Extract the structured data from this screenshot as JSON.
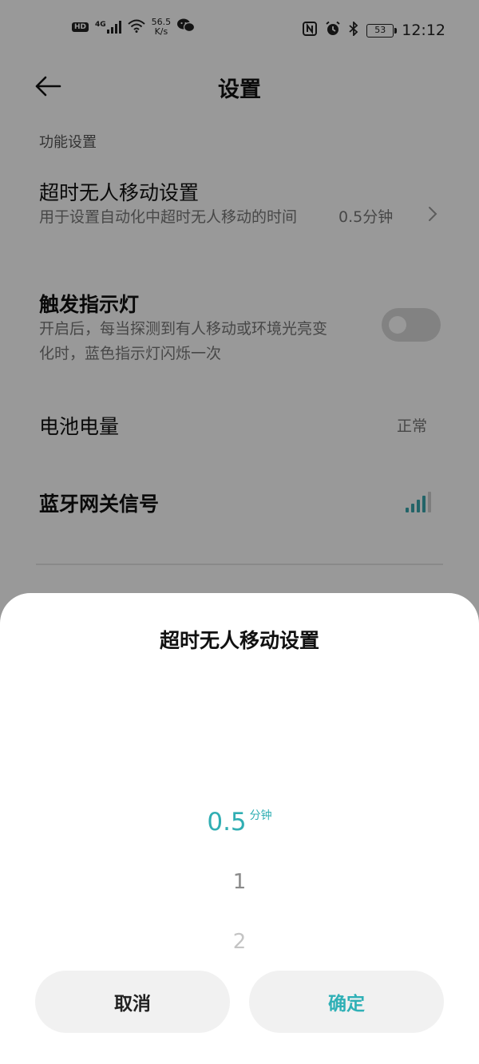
{
  "status_bar": {
    "hd_badge": "HD",
    "network": "4G",
    "speed_value": "56.5",
    "speed_unit": "K/s",
    "battery_level": "53",
    "time": "12:12",
    "left_icons": [
      "hd-icon",
      "signal-4g-icon",
      "wifi-icon",
      "wechat-icon"
    ],
    "right_icons": [
      "nfc-icon",
      "alarm-icon",
      "bluetooth-icon",
      "battery-icon"
    ]
  },
  "header": {
    "title": "设置",
    "back_icon": "arrow-left-icon"
  },
  "section": {
    "title": "功能设置"
  },
  "settings": {
    "timeout": {
      "title": "超时无人移动设置",
      "description": "用于设置自动化中超时无人移动的时间",
      "value": "0.5分钟"
    },
    "indicator": {
      "title": "触发指示灯",
      "description": "开启后，每当探测到有人移动或环境光亮变化时，蓝色指示灯闪烁一次",
      "enabled": false
    },
    "battery": {
      "title": "电池电量",
      "value": "正常"
    },
    "gateway_signal": {
      "title": "蓝牙网关信号",
      "level": 4,
      "max_level": 5
    }
  },
  "sheet": {
    "title": "超时无人移动设置",
    "picker": {
      "selected_value": "0.5",
      "selected_unit": "分钟",
      "options": [
        "1",
        "2"
      ]
    },
    "cancel_label": "取消",
    "confirm_label": "确定"
  },
  "colors": {
    "accent": "#30aeb3",
    "overlay": "rgba(0,0,0,0.40)",
    "signal_active": "#3aa7ad",
    "signal_inactive": "#d0d0d0"
  }
}
